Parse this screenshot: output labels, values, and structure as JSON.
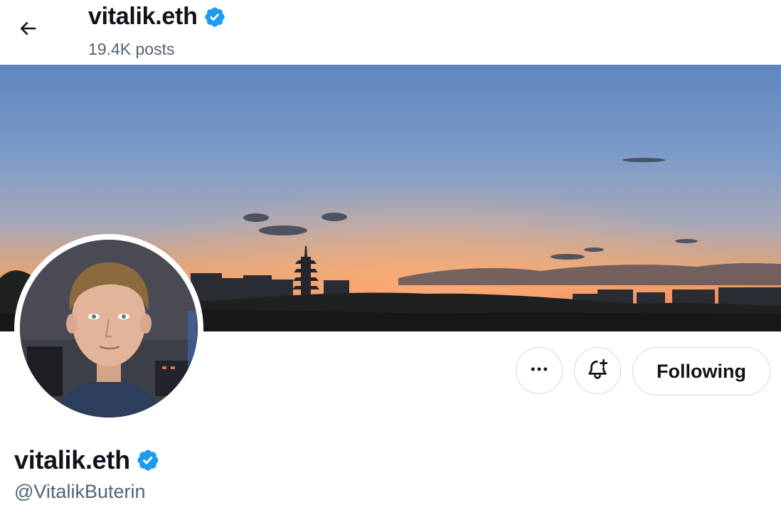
{
  "header": {
    "back_icon": "arrow-left-icon",
    "name": "vitalik.eth",
    "posts_count": "19.4K posts",
    "verified_icon": "verified-badge-icon"
  },
  "banner": {
    "description_icon": "banner-image"
  },
  "actions": {
    "more_icon": "more-dots-icon",
    "notify_icon": "bell-plus-icon",
    "following_label": "Following"
  },
  "profile": {
    "display_name": "vitalik.eth",
    "handle": "@VitalikButerin"
  },
  "colors": {
    "verified": "#1d9bf0",
    "text": "#0f1419",
    "secondary_text": "#536471",
    "border": "#cfd9de"
  }
}
